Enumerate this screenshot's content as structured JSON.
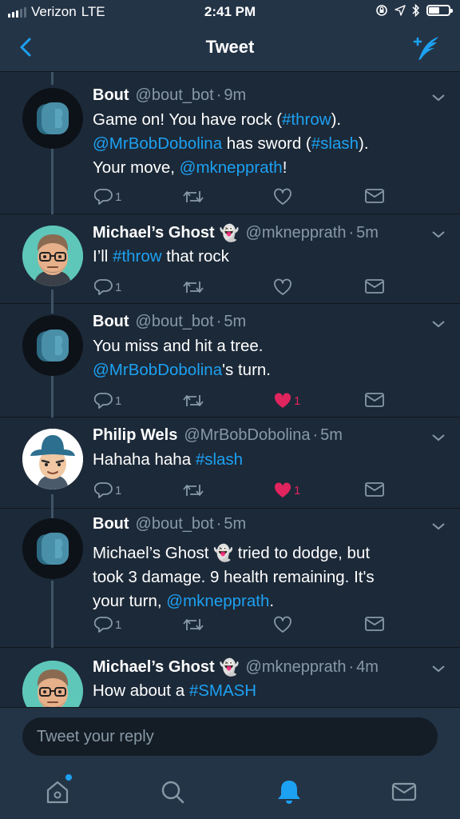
{
  "status_bar": {
    "carrier": "Verizon",
    "network": "LTE",
    "time": "2:41 PM",
    "battery_level": 0.55
  },
  "header": {
    "title": "Tweet",
    "back_icon": "chevron-left-icon",
    "compose_icon": "compose-tweet-icon"
  },
  "colors": {
    "background": "#1c2938",
    "bar": "#243447",
    "accent": "#1da1f2",
    "muted": "#8899a6",
    "like": "#e0245e"
  },
  "tweets": [
    {
      "name": "Bout",
      "handle": "@bout_bot",
      "dot": "·",
      "age": "9m",
      "text_parts": [
        "Game on! You have rock (",
        "#throw",
        ").",
        "@MrBobDobolina",
        " has sword (",
        "#slash",
        ").",
        "Your move, ",
        "@mknepprath",
        "!"
      ],
      "replies": "1",
      "likes": ""
    },
    {
      "name": "Michael’s Ghost",
      "emoji": "👻",
      "handle": "@mknepprath",
      "dot": "·",
      "age": "5m",
      "text_parts": [
        "I’ll ",
        "#throw",
        " that rock"
      ],
      "replies": "1",
      "likes": ""
    },
    {
      "name": "Bout",
      "handle": "@bout_bot",
      "dot": "·",
      "age": "5m",
      "text_parts": [
        "You miss and hit a tree.",
        "@MrBobDobolina",
        "'s turn."
      ],
      "replies": "1",
      "likes": "1"
    },
    {
      "name": "Philip Wels",
      "handle": "@MrBobDobolina",
      "dot": "·",
      "age": "5m",
      "text_parts": [
        "Hahaha haha ",
        "#slash"
      ],
      "replies": "1",
      "likes": "1"
    },
    {
      "name": "Bout",
      "handle": "@bout_bot",
      "dot": "·",
      "age": "5m",
      "text_parts": [
        "Michael’s Ghost ",
        "👻",
        " tried to dodge, but",
        "took 3 damage. 9 health remaining. It's",
        "your turn, ",
        "@mknepprath",
        "."
      ],
      "replies": "1",
      "likes": ""
    },
    {
      "name": "Michael’s Ghost",
      "emoji": "👻",
      "handle": "@mknepprath",
      "dot": "·",
      "age": "4m",
      "text_parts": [
        "How about a ",
        "#SMASH"
      ]
    }
  ],
  "reply": {
    "placeholder": "Tweet your reply"
  },
  "tab_bar": {
    "items": [
      "home-icon",
      "search-icon",
      "notifications-bell-icon",
      "messages-icon"
    ],
    "active": "notifications-bell-icon"
  }
}
